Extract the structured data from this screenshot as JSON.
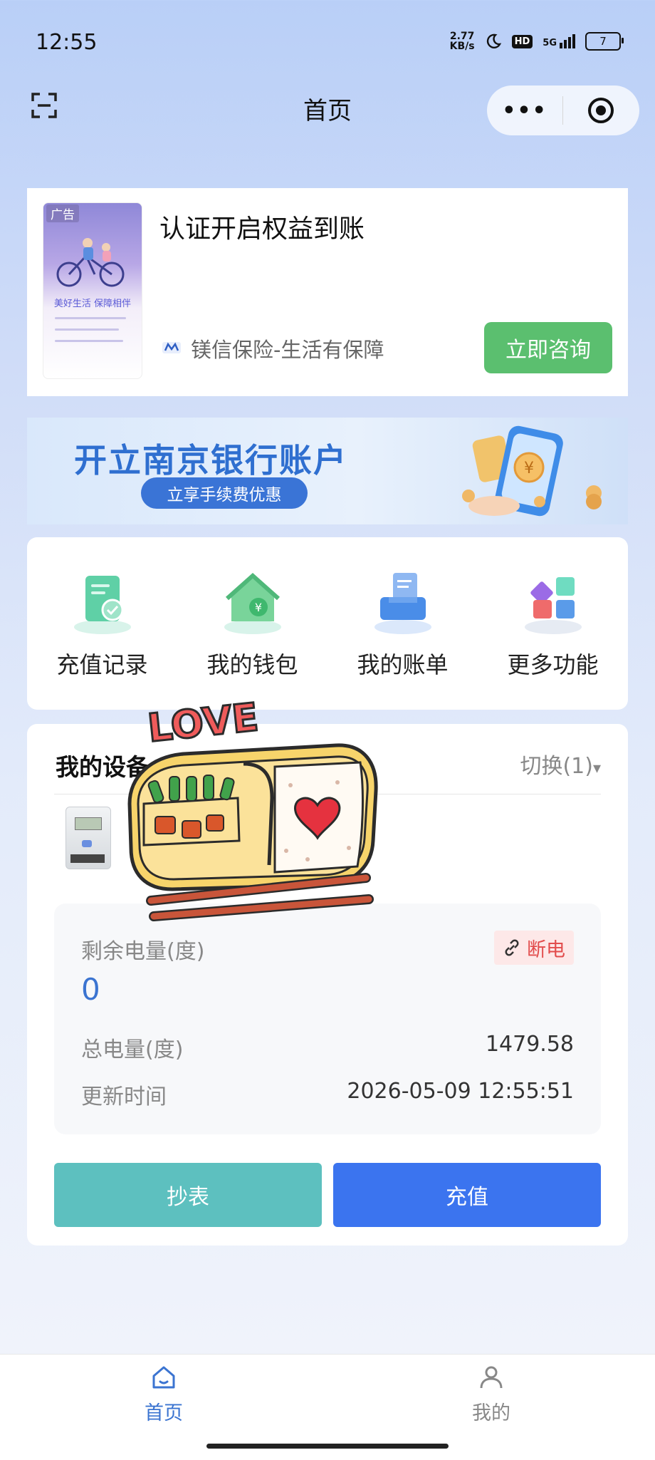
{
  "status_bar": {
    "time": "12:55",
    "net_speed_value": "2.77",
    "net_speed_unit": "KB/s",
    "hd": "HD",
    "signal": "5G",
    "battery": "7"
  },
  "nav": {
    "title": "首页",
    "more_label": "•••"
  },
  "ad": {
    "tag": "广告",
    "image_text": "美好生活 保障相伴",
    "title": "认证开启权益到账",
    "brand": "镁信保险-生活有保障",
    "button": "立即咨询"
  },
  "bank_banner": {
    "title": "开立南京银行账户",
    "subtitle": "立享手续费优惠"
  },
  "features": [
    {
      "label": "充值记录",
      "icon": "recharge-record-icon"
    },
    {
      "label": "我的钱包",
      "icon": "wallet-icon"
    },
    {
      "label": "我的账单",
      "icon": "bill-icon"
    },
    {
      "label": "更多功能",
      "icon": "more-functions-icon"
    }
  ],
  "devices": {
    "title": "我的设备",
    "switch_label": "切换(1)",
    "remain_label": "剩余电量(度)",
    "remain_value": "0",
    "status_badge": "断电",
    "total_label": "总电量(度)",
    "total_value": "1479.58",
    "update_label": "更新时间",
    "update_value": "2026-05-09 12:55:51",
    "read_button": "抄表",
    "charge_button": "充值"
  },
  "sticker": {
    "text": "LOVE"
  },
  "tabbar": {
    "home": "首页",
    "mine": "我的"
  },
  "colors": {
    "accent_blue": "#3b74ef",
    "teal": "#5dc0bf",
    "green": "#5bbf6f",
    "alert_red": "#e24c4c"
  }
}
